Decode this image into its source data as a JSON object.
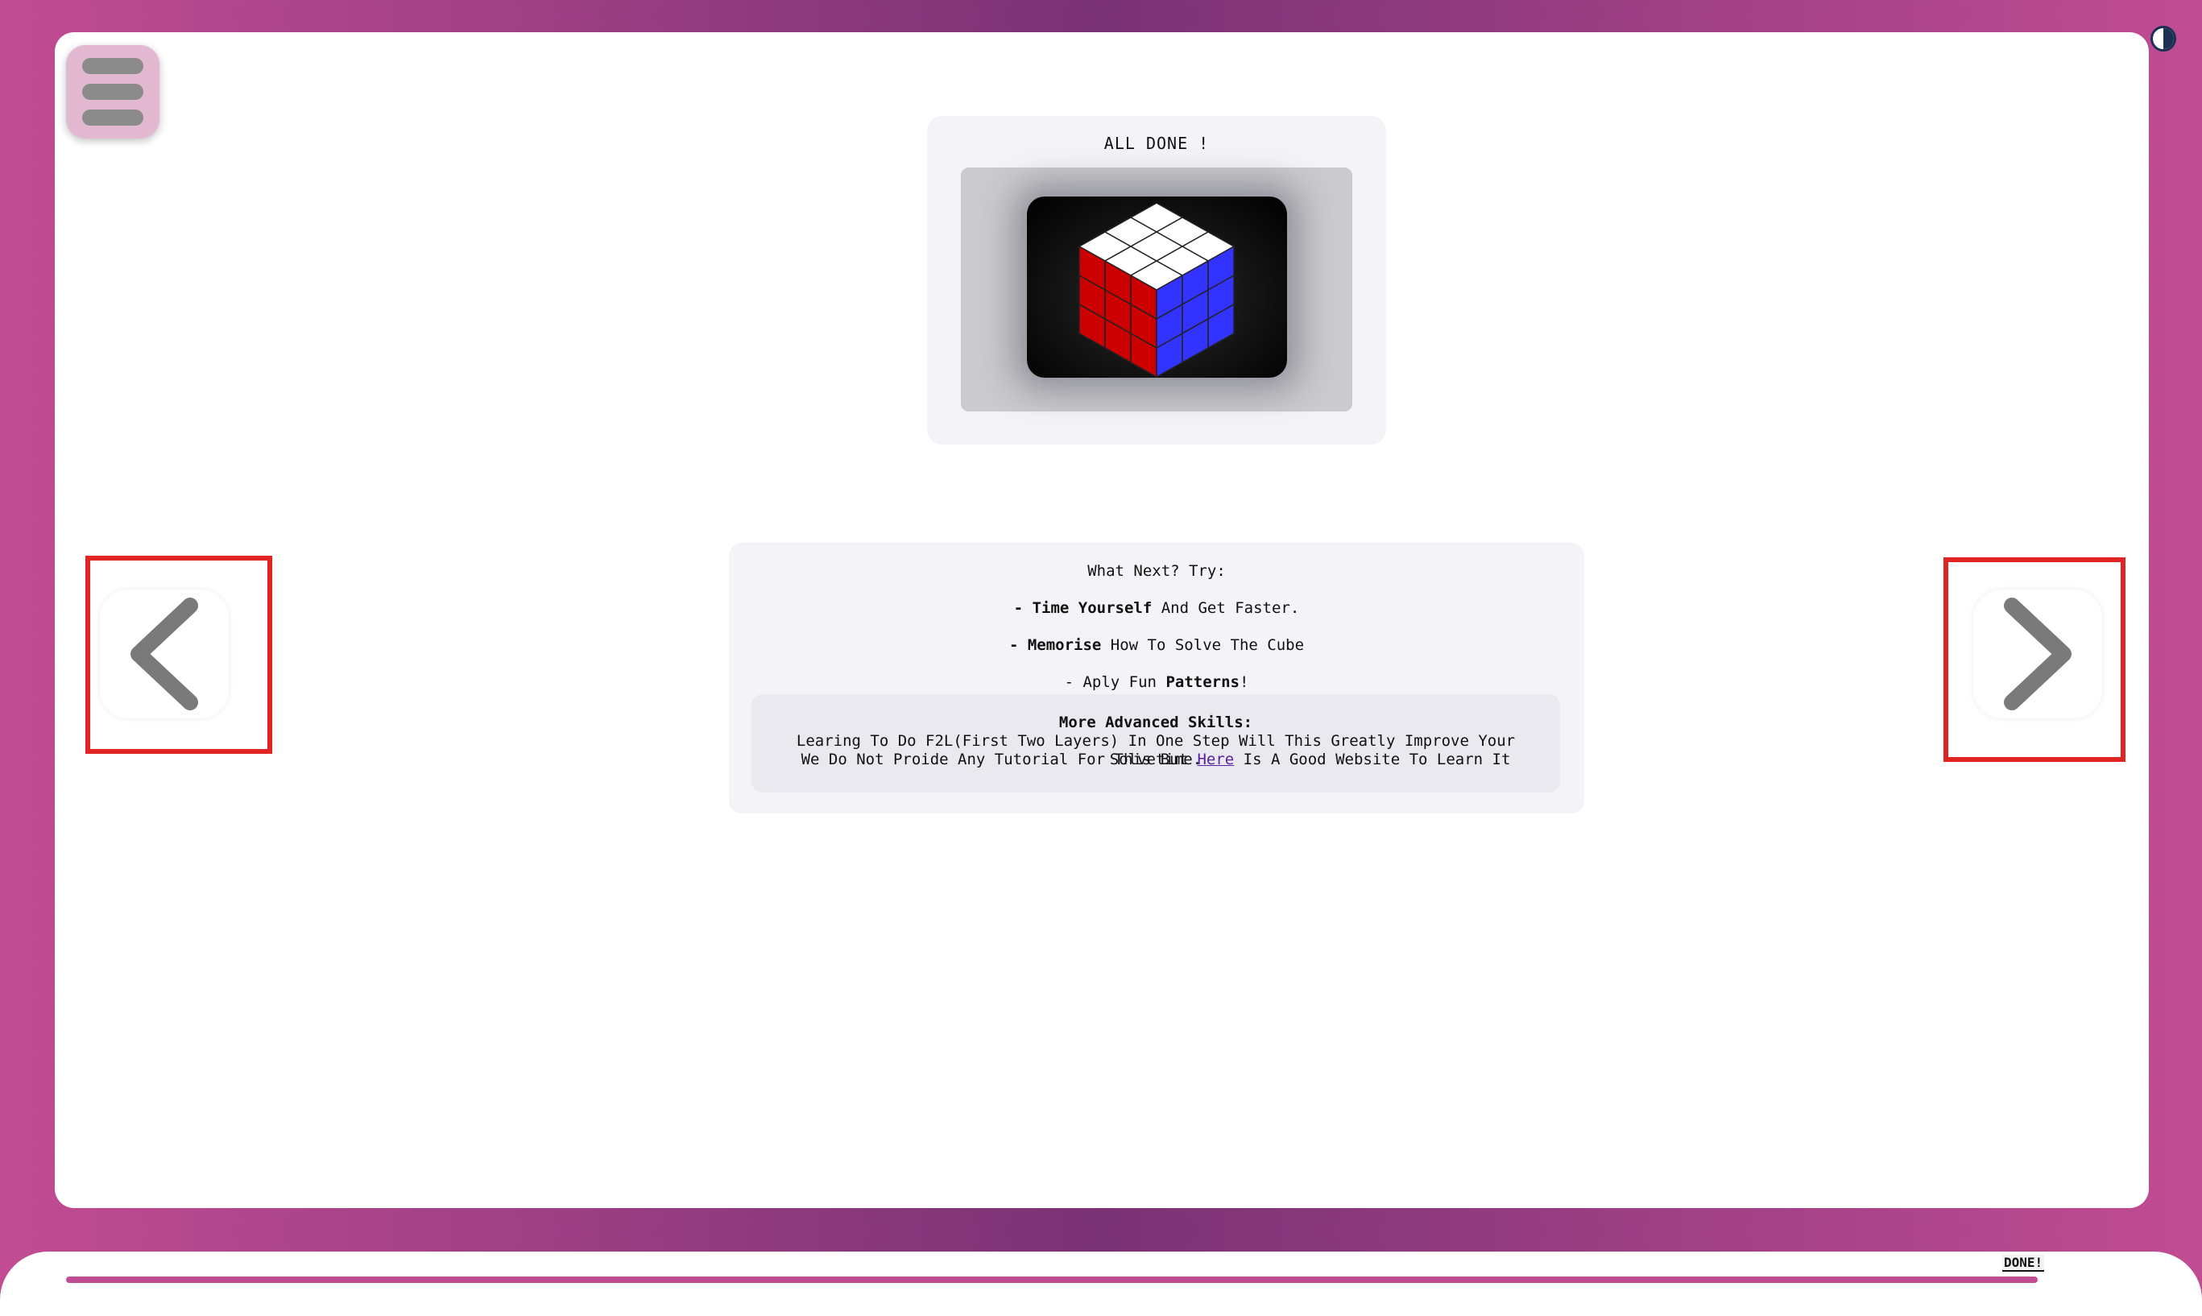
{
  "header": {
    "menu_icon": "hamburger-icon",
    "theme_icon": "contrast-icon"
  },
  "done_card": {
    "title": "ALL DONE !",
    "image_alt": "solved-cube-icon"
  },
  "next_card": {
    "heading": "What Next? Try:",
    "item1_bold": "Time Yourself",
    "item1_rest": " And Get Faster.",
    "item2_bold": "Memorise",
    "item2_rest": " How To Solve The Cube",
    "item3_prefix": "- Aply Fun ",
    "item3_bold": "Patterns",
    "item3_suffix": "!",
    "dash": "- ",
    "advanced_title": "More Advanced Skills:",
    "advanced_line1": "Learing To Do F2L(First Two Layers) In One Step Will This Greatly Improve Your Solvetime.",
    "advanced_line2_prefix": "We Do Not Proide Any Tutorial For This But ",
    "advanced_link": "Here",
    "advanced_line2_suffix": " Is A Good Website To Learn It"
  },
  "nav": {
    "prev_icon": "chevron-left-icon",
    "next_icon": "chevron-right-icon"
  },
  "footer": {
    "status": "DONE!",
    "progress": 1.0
  },
  "colors": {
    "accent": "#c14c93",
    "highlight": "#e02424",
    "cube_red": "#cc0000",
    "cube_blue": "#3333ff",
    "cube_white": "#ffffff"
  }
}
